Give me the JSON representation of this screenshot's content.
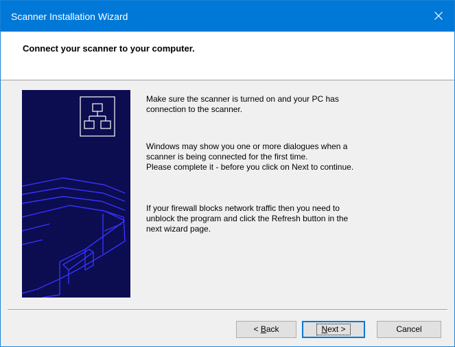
{
  "window": {
    "title": "Scanner Installation Wizard"
  },
  "header": {
    "heading": "Connect your scanner to your computer."
  },
  "icons": {
    "close": "close-icon",
    "network": "network-icon",
    "scanner_illustration": "scanner-illustration"
  },
  "body": {
    "paragraph1_line1": "Make sure the scanner is turned on and your PC has",
    "paragraph1_line2": "connection to the scanner.",
    "paragraph2_line1": "Windows may show you one or more dialogues when a",
    "paragraph2_line2": "scanner is being connected for the first time.",
    "paragraph2_line3": "Please complete it - before you click on Next to continue.",
    "paragraph3_line1": "If your firewall blocks network traffic then you need to",
    "paragraph3_line2": "unblock the program and click the Refresh button in the",
    "paragraph3_line3": "next wizard page."
  },
  "buttons": {
    "back_prefix": "< ",
    "back_mnemonic": "B",
    "back_rest": "ack",
    "next_mnemonic": "N",
    "next_rest": "ext >",
    "cancel": "Cancel"
  },
  "colors": {
    "titlebar": "#0078d7",
    "side_panel_bg": "#0a0a4a",
    "side_panel_lines": "#3a3aff"
  }
}
